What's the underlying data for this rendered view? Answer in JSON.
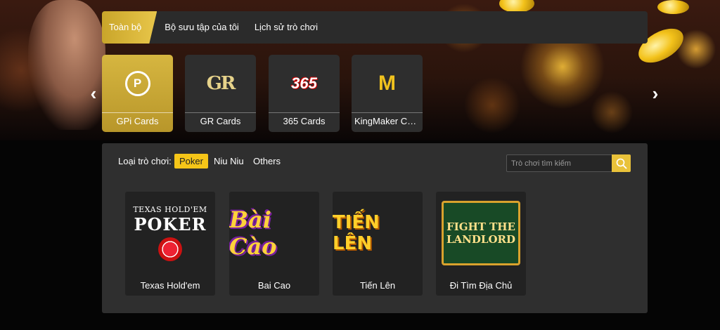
{
  "tabs": [
    {
      "label": "Toàn bộ",
      "active": true
    },
    {
      "label": "Bộ sưu tập của tôi",
      "active": false
    },
    {
      "label": "Lịch sử trò chơi",
      "active": false
    }
  ],
  "providers": [
    {
      "label": "GPi Cards",
      "active": true,
      "logo": "gpi-logo-icon",
      "logo_text": "P"
    },
    {
      "label": "GR Cards",
      "active": false,
      "logo": "gr-logo-icon",
      "logo_text": "GR"
    },
    {
      "label": "365 Cards",
      "active": false,
      "logo": "365-logo-icon",
      "logo_text": "365"
    },
    {
      "label": "KingMaker Ca...",
      "active": false,
      "logo": "kingmaker-logo-icon",
      "logo_text": "M"
    }
  ],
  "nav": {
    "prev_glyph": "‹",
    "next_glyph": "›"
  },
  "filter": {
    "label": "Loại trò chơi:",
    "options": [
      {
        "label": "Poker",
        "active": true
      },
      {
        "label": "Niu Niu",
        "active": false
      },
      {
        "label": "Others",
        "active": false
      }
    ]
  },
  "search": {
    "placeholder": "Trò chơi tìm kiếm",
    "value": ""
  },
  "games": [
    {
      "label": "Texas Hold'em",
      "art_line1": "TEXAS HOLD'EM",
      "art_line2": "POKER"
    },
    {
      "label": "Bai Cao",
      "art_line1": "Bài Cào"
    },
    {
      "label": "Tiến Lên",
      "art_line1": "TIẾN LÊN"
    },
    {
      "label": "Đi Tìm Địa Chủ",
      "art_line1": "FIGHT THE",
      "art_line2": "LANDLORD"
    }
  ],
  "colors": {
    "accent": "#f5c518",
    "panel": "#2f2f2f",
    "tab_active": "#d6b640"
  }
}
